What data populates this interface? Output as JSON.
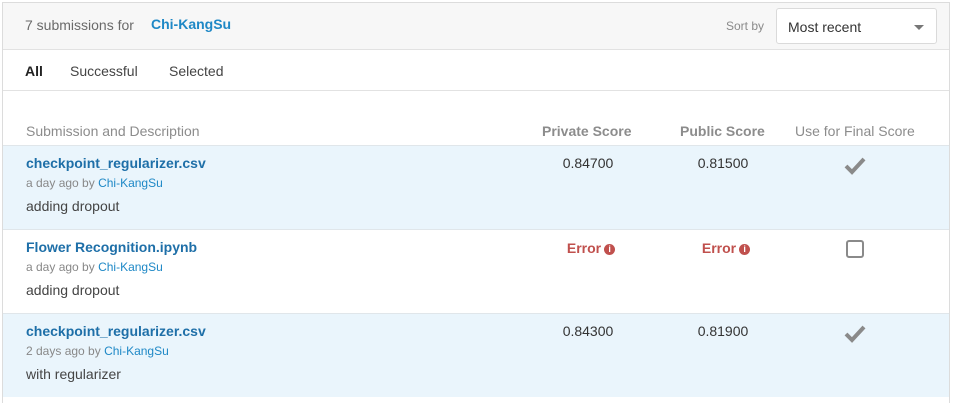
{
  "header": {
    "count_text": "7 submissions for",
    "user": "Chi-KangSu",
    "sort_label": "Sort by",
    "sort_value": "Most recent"
  },
  "tabs": [
    {
      "label": "All",
      "active": true
    },
    {
      "label": "Successful",
      "active": false
    },
    {
      "label": "Selected",
      "active": false
    }
  ],
  "columns": {
    "submission": "Submission and Description",
    "private": "Private Score",
    "public": "Public Score",
    "final": "Use for Final Score"
  },
  "rows": [
    {
      "file": "checkpoint_regularizer.csv",
      "time": "a day ago by",
      "user": "Chi-KangSu",
      "description": "adding dropout",
      "private_score": "0.84700",
      "public_score": "0.81500",
      "final": "checked",
      "highlighted": true
    },
    {
      "file": "Flower Recognition.ipynb",
      "time": "a day ago by",
      "user": "Chi-KangSu",
      "description": "adding dropout",
      "private_score": "Error",
      "public_score": "Error",
      "final": "unchecked",
      "highlighted": false
    },
    {
      "file": "checkpoint_regularizer.csv",
      "time": "2 days ago by",
      "user": "Chi-KangSu",
      "description": "with regularizer",
      "private_score": "0.84300",
      "public_score": "0.81900",
      "final": "checked",
      "highlighted": true
    }
  ],
  "colors": {
    "link": "#1e6fa8",
    "error": "#c0504d",
    "highlight_row": "#eaf5fc",
    "check": "#8a8a8a"
  }
}
